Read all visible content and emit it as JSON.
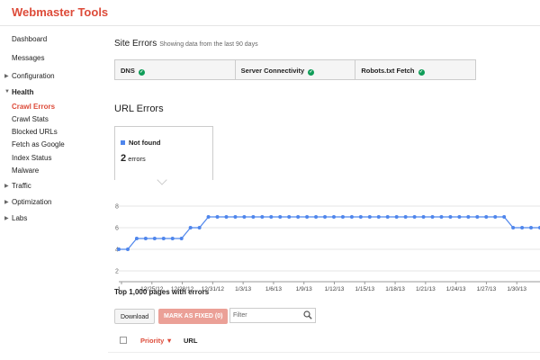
{
  "app": {
    "title": "Webmaster Tools"
  },
  "sidebar": {
    "items": [
      {
        "label": "Dashboard",
        "type": "link"
      },
      {
        "label": "Messages",
        "type": "link"
      },
      {
        "label": "Configuration",
        "type": "group"
      },
      {
        "label": "Health",
        "type": "group-open"
      },
      {
        "label": "Crawl Errors",
        "type": "active"
      },
      {
        "label": "Crawl Stats",
        "type": "sub"
      },
      {
        "label": "Blocked URLs",
        "type": "sub"
      },
      {
        "label": "Fetch as Google",
        "type": "sub"
      },
      {
        "label": "Index Status",
        "type": "sub"
      },
      {
        "label": "Malware",
        "type": "sub"
      },
      {
        "label": "Traffic",
        "type": "group"
      },
      {
        "label": "Optimization",
        "type": "group"
      },
      {
        "label": "Labs",
        "type": "group"
      }
    ]
  },
  "site_errors": {
    "title": "Site Errors",
    "subtitle": "Showing data from the last 90 days",
    "checks": [
      {
        "label": "DNS",
        "status_icon": "check-circle-icon"
      },
      {
        "label": "Server Connectivity",
        "status_icon": "check-circle-icon"
      },
      {
        "label": "Robots.txt Fetch",
        "status_icon": "check-circle-icon"
      }
    ]
  },
  "url_errors": {
    "title": "URL Errors",
    "legend_label": "Not found",
    "count_value": "2",
    "count_unit": "errors"
  },
  "chart_data": {
    "type": "line",
    "series": [
      {
        "values": [
          4,
          4,
          5,
          5,
          5,
          5,
          5,
          5,
          6,
          6,
          7,
          7,
          7,
          7,
          7,
          7,
          7,
          7,
          7,
          7,
          7,
          7,
          7,
          7,
          7,
          7,
          7,
          7,
          7,
          7,
          7,
          7,
          7,
          7,
          7,
          7,
          7,
          7,
          7,
          7,
          7,
          7,
          7,
          7,
          6,
          6,
          6,
          6
        ]
      }
    ],
    "x_tick_labels": [
      "1...",
      "12/25/12",
      "12/28/12",
      "12/31/12",
      "1/3/13",
      "1/6/13",
      "1/9/13",
      "1/12/13",
      "1/15/13",
      "1/18/13",
      "1/21/13",
      "1/24/13",
      "1/27/13",
      "1/30/13",
      "2/"
    ],
    "y_ticks": [
      2,
      4,
      6,
      8
    ],
    "ylim": [
      1,
      8.5
    ],
    "color": "#4f86ec",
    "grid": true
  },
  "table": {
    "caption": "Top 1,000 pages with errors",
    "download_label": "Download",
    "mark_fixed_label": "MARK AS FIXED (0)",
    "filter_placeholder": "Filter",
    "col_priority": "Priority",
    "col_url": "URL"
  },
  "colors": {
    "brand": "#dd4b39",
    "series": "#4f86ec",
    "ok": "#0f9d58"
  }
}
